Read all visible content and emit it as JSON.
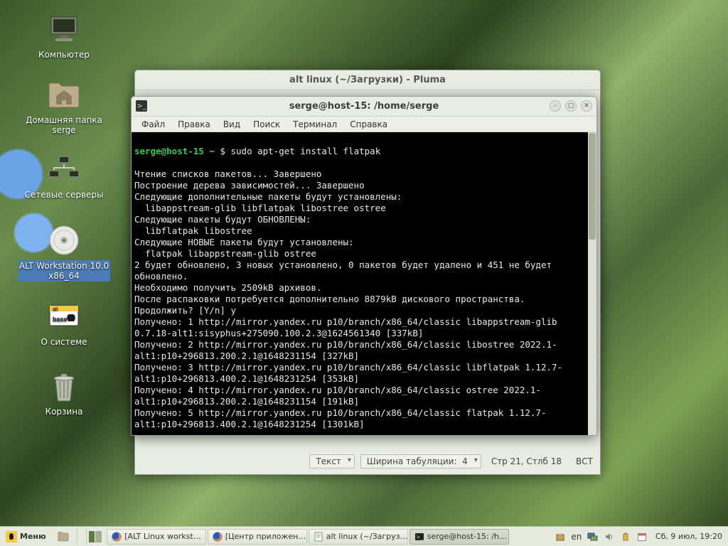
{
  "desktop_icons": [
    {
      "id": "computer",
      "label": "Компьютер"
    },
    {
      "id": "home",
      "label": "Домашняя папка\nserge"
    },
    {
      "id": "network",
      "label": "Сетевые серверы"
    },
    {
      "id": "disc",
      "label": "ALT Workstation 10.0\nx86_64",
      "selected": true
    },
    {
      "id": "about",
      "label": "О системе"
    },
    {
      "id": "trash",
      "label": "Корзина"
    }
  ],
  "pluma": {
    "title": "alt linux (~/Загрузки) - Pluma",
    "status": {
      "syntax": "Текст",
      "tabwidth_label": "Ширина табуляции:",
      "tabwidth_value": "4",
      "cursor": "Стр 21, Стлб 18",
      "insert_mode": "ВСТ"
    }
  },
  "terminal": {
    "title": "serge@host-15: /home/serge",
    "menus": [
      "Файл",
      "Правка",
      "Вид",
      "Поиск",
      "Терминал",
      "Справка"
    ],
    "prompt_user": "serge@host-15",
    "prompt_path": "~",
    "prompt_sym": "$",
    "command": "sudo apt-get install flatpak",
    "lines": [
      "Чтение списков пакетов... Завершено",
      "Построение дерева зависимостей... Завершено",
      "Следующие дополнительные пакеты будут установлены:",
      "  libappstream-glib libflatpak libostree ostree",
      "Следующие пакеты будут ОБНОВЛЕНЫ:",
      "  libflatpak libostree",
      "Следующие НОВЫЕ пакеты будут установлены:",
      "  flatpak libappstream-glib ostree",
      "2 будет обновлено, 3 новых установлено, 0 пакетов будет удалено и 451 не будет обновлено.",
      "Необходимо получить 2509kB архивов.",
      "После распаковки потребуется дополнительно 8879kB дискового пространства.",
      "Продолжить? [Y/n] y",
      "Получено: 1 http://mirror.yandex.ru p10/branch/x86_64/classic libappstream-glib 0.7.18-alt1:sisyphus+275090.100.2.3@1624561340 [337kB]",
      "Получено: 2 http://mirror.yandex.ru p10/branch/x86_64/classic libostree 2022.1-alt1:p10+296813.200.2.1@1648231154 [327kB]",
      "Получено: 3 http://mirror.yandex.ru p10/branch/x86_64/classic libflatpak 1.12.7-alt1:p10+296813.400.2.1@1648231254 [353kB]",
      "Получено: 4 http://mirror.yandex.ru p10/branch/x86_64/classic ostree 2022.1-alt1:p10+296813.200.2.1@1648231154 [191kB]",
      "Получено: 5 http://mirror.yandex.ru p10/branch/x86_64/classic flatpak 1.12.7-alt1:p10+296813.400.2.1@1648231254 [1301kB]"
    ]
  },
  "panel": {
    "menu_label": "Меню",
    "tasks": [
      {
        "label": "[ALT Linux workst…",
        "icon": "firefox"
      },
      {
        "label": "[Центр приложен…",
        "icon": "firefox"
      },
      {
        "label": "alt linux (~/Загруз…",
        "icon": "editor"
      },
      {
        "label": "serge@host-15: /h…",
        "icon": "terminal",
        "active": true
      }
    ],
    "lang": "en",
    "clock": "Сб,  9 июл, 19:20"
  },
  "colors": {
    "term_fg": "#00ff66",
    "term_bg": "#000000",
    "accent": "#5a7c3f"
  }
}
